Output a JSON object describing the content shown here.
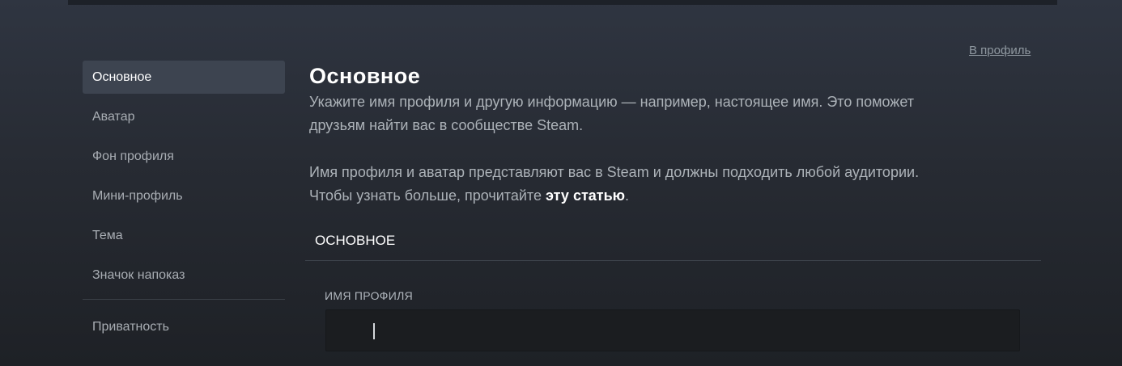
{
  "sidebar": {
    "items": [
      {
        "label": "Основное"
      },
      {
        "label": "Аватар"
      },
      {
        "label": "Фон профиля"
      },
      {
        "label": "Мини-профиль"
      },
      {
        "label": "Тема"
      },
      {
        "label": "Значок напоказ"
      }
    ],
    "privacy_label": "Приватность"
  },
  "header": {
    "profile_link": "В профиль"
  },
  "main": {
    "title": "Основное",
    "intro_line1": "Укажите имя профиля и другую информацию — например, настоящее имя. Это поможет",
    "intro_line2": "друзьям найти вас в сообществе Steam.",
    "policy_line1": "Имя профиля и аватар представляют вас в Steam и должны подходить любой аудитории.",
    "policy_line2_prefix": "Чтобы узнать больше, прочитайте ",
    "policy_link": "эту статью",
    "policy_line2_suffix": "."
  },
  "section": {
    "header": "ОСНОВНОЕ",
    "profile_name_label": "ИМЯ ПРОФИЛЯ",
    "profile_name_value": ""
  }
}
